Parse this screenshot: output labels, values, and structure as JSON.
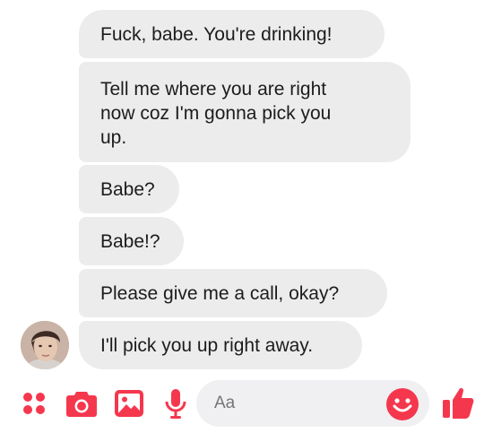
{
  "conversation": {
    "messages": [
      {
        "text": "Fuck, babe. You're drinking!"
      },
      {
        "text": "Tell me where you are right\nnow coz I'm gonna pick you\nup."
      },
      {
        "text": "Babe?"
      },
      {
        "text": "Babe!?"
      },
      {
        "text": "Please give me a call, okay?"
      },
      {
        "text": "I'll pick you up right away."
      }
    ],
    "sender_avatar": "avatar"
  },
  "composer": {
    "placeholder": "Aa",
    "tools": [
      "more-icon",
      "camera-icon",
      "gallery-icon",
      "microphone-icon"
    ],
    "emoji": "smiley-icon",
    "send": "thumbs-up-icon"
  },
  "colors": {
    "accent": "#f5374e",
    "bubble": "#ececec",
    "text": "#1c1c1c",
    "input_bg": "#f0f0f2",
    "placeholder": "#8e8e93"
  }
}
